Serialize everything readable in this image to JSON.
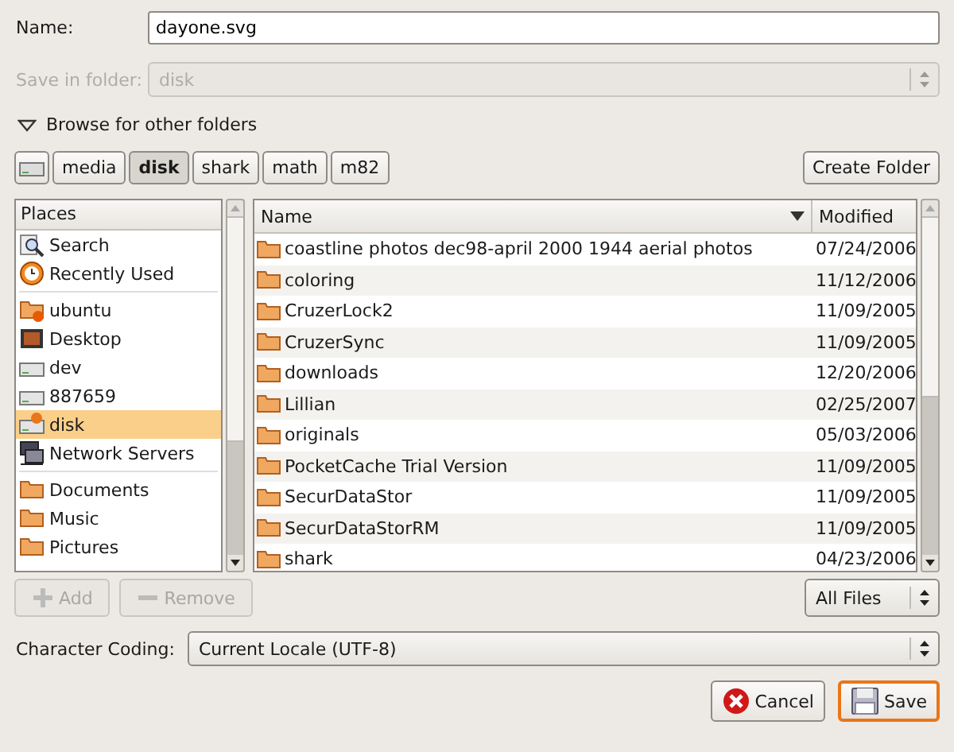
{
  "name_field": {
    "label": "Name:",
    "value": "dayone.svg"
  },
  "save_in_folder": {
    "label": "Save in folder:",
    "value": "disk",
    "disabled": true
  },
  "browse": {
    "label": "Browse for other folders",
    "expanded": true
  },
  "path_bar": [
    {
      "label": "media",
      "selected": false
    },
    {
      "label": "disk",
      "selected": true
    },
    {
      "label": "shark",
      "selected": false
    },
    {
      "label": "math",
      "selected": false
    },
    {
      "label": "m82",
      "selected": false
    }
  ],
  "create_folder": "Create Folder",
  "places": {
    "header": "Places",
    "sections": [
      {
        "items": [
          {
            "kind": "search",
            "label": "Search",
            "selected": false
          },
          {
            "kind": "recent",
            "label": "Recently Used",
            "selected": false
          }
        ]
      },
      {
        "items": [
          {
            "kind": "home",
            "label": "ubuntu",
            "selected": false
          },
          {
            "kind": "desktop",
            "label": "Desktop",
            "selected": false
          },
          {
            "kind": "drive",
            "label": "dev",
            "selected": false
          },
          {
            "kind": "drive",
            "label": "887659",
            "selected": false
          },
          {
            "kind": "drive",
            "label": "disk",
            "selected": true
          },
          {
            "kind": "network",
            "label": "Network Servers",
            "selected": false
          }
        ]
      },
      {
        "items": [
          {
            "kind": "folder",
            "label": "Documents",
            "selected": false
          },
          {
            "kind": "folder",
            "label": "Music",
            "selected": false
          },
          {
            "kind": "folder",
            "label": "Pictures",
            "selected": false
          }
        ]
      }
    ]
  },
  "files": {
    "columns": [
      "Name",
      "Modified"
    ],
    "rows": [
      {
        "name": "coastline photos dec98-april 2000 1944 aerial photos",
        "modified": "07/24/2006"
      },
      {
        "name": "coloring",
        "modified": "11/12/2006"
      },
      {
        "name": "CruzerLock2",
        "modified": "11/09/2005"
      },
      {
        "name": "CruzerSync",
        "modified": "11/09/2005"
      },
      {
        "name": "downloads",
        "modified": "12/20/2006"
      },
      {
        "name": "Lillian",
        "modified": "02/25/2007"
      },
      {
        "name": "originals",
        "modified": "05/03/2006"
      },
      {
        "name": "PocketCache Trial Version",
        "modified": "11/09/2005"
      },
      {
        "name": "SecurDataStor",
        "modified": "11/09/2005"
      },
      {
        "name": "SecurDataStorRM",
        "modified": "11/09/2005"
      },
      {
        "name": "shark",
        "modified": "04/23/2006"
      }
    ]
  },
  "add_button": {
    "label": "Add",
    "disabled": true
  },
  "remove_button": {
    "label": "Remove",
    "disabled": true
  },
  "filter": "All Files",
  "character_coding": {
    "label": "Character Coding:",
    "value": "Current Locale (UTF-8)"
  },
  "buttons": [
    {
      "kind": "cancel",
      "label": "Cancel",
      "default": false
    },
    {
      "kind": "save",
      "label": "Save",
      "default": true
    }
  ]
}
